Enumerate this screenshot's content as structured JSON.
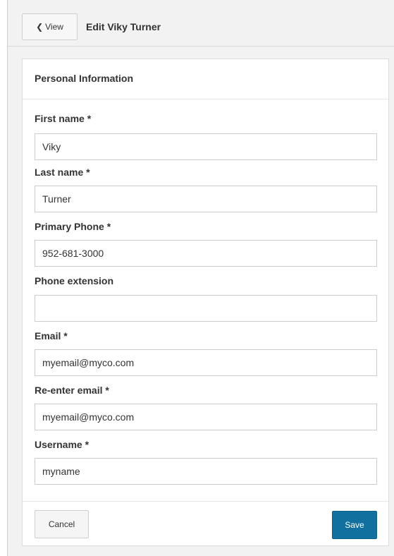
{
  "header": {
    "back_label": "View",
    "title": "Edit Viky Turner"
  },
  "section": {
    "title": "Personal Information"
  },
  "fields": {
    "first_name": {
      "label": "First name *",
      "value": "Viky"
    },
    "last_name": {
      "label": "Last name *",
      "value": "Turner"
    },
    "primary_phone": {
      "label": "Primary Phone *",
      "value": "952-681-3000"
    },
    "phone_extension": {
      "label": "Phone extension",
      "value": ""
    },
    "email": {
      "label": "Email *",
      "value": "myemail@myco.com"
    },
    "reenter_email": {
      "label": "Re-enter email *",
      "value": "myemail@myco.com"
    },
    "username": {
      "label": "Username *",
      "value": "myname"
    }
  },
  "footer": {
    "cancel_label": "Cancel",
    "save_label": "Save"
  },
  "colors": {
    "primary": "#11709d",
    "background": "#f2f2f2",
    "card": "#ffffff"
  },
  "icons": {
    "back": "chevron-left-icon"
  }
}
